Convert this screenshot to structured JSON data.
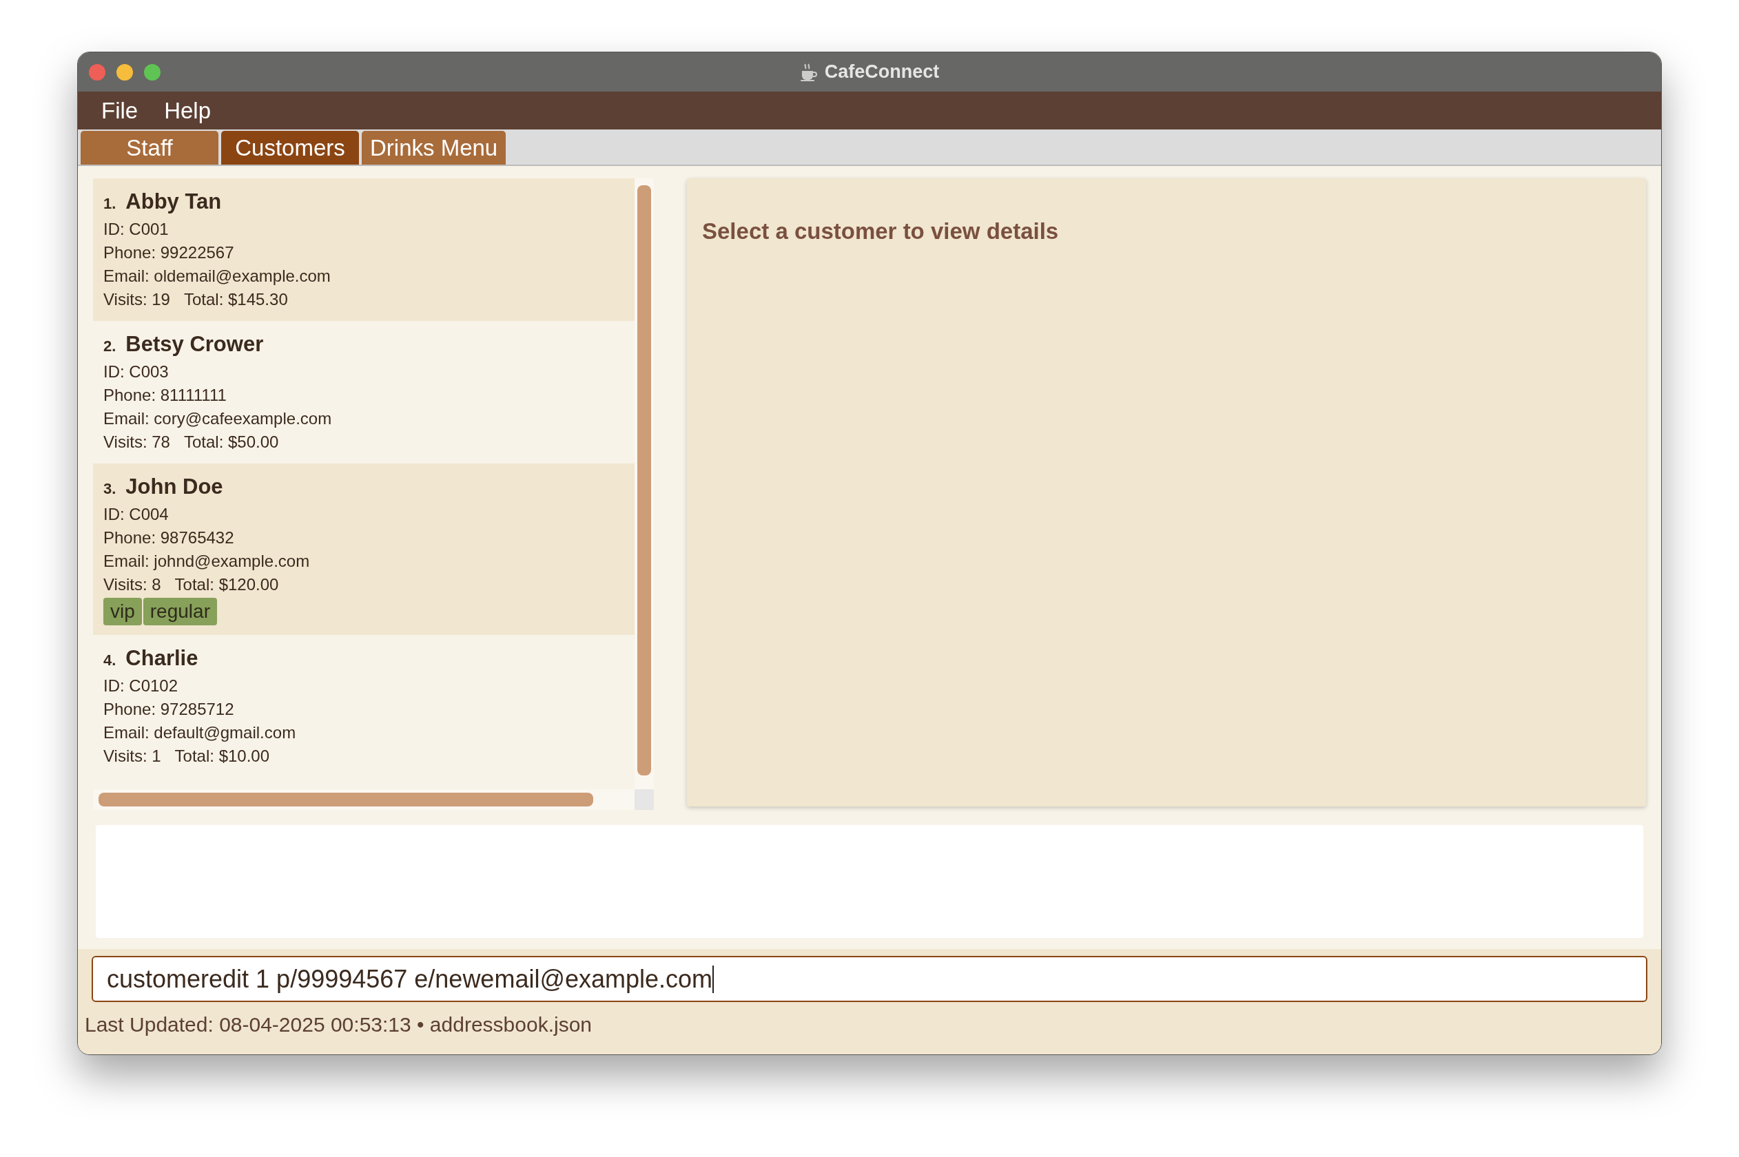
{
  "window": {
    "title": "CafeConnect"
  },
  "menu": [
    "File",
    "Help"
  ],
  "tabs": [
    {
      "label": "Staff",
      "selected": false
    },
    {
      "label": "Customers",
      "selected": true
    },
    {
      "label": "Drinks Menu",
      "selected": false
    }
  ],
  "customers": [
    {
      "index": "1.",
      "name": "Abby Tan",
      "id": "ID: C001",
      "phone": "Phone: 99222567",
      "email": "Email: oldemail@example.com",
      "visits": "Visits: 19",
      "total": "Total: $145.30"
    },
    {
      "index": "2.",
      "name": "Betsy Crower",
      "id": "ID: C003",
      "phone": "Phone: 81111111",
      "email": "Email: cory@cafeexample.com",
      "visits": "Visits: 78",
      "total": "Total: $50.00"
    },
    {
      "index": "3.",
      "name": "John Doe",
      "id": "ID: C004",
      "phone": "Phone: 98765432",
      "email": "Email: johnd@example.com",
      "visits": "Visits: 8",
      "total": "Total: $120.00",
      "tags": [
        "vip",
        "regular"
      ]
    },
    {
      "index": "4.",
      "name": "Charlie",
      "id": "ID: C0102",
      "phone": "Phone: 97285712",
      "email": "Email: default@gmail.com",
      "visits": "Visits: 1",
      "total": "Total: $10.00"
    }
  ],
  "details": {
    "placeholder_message": "Select a customer to view details"
  },
  "command_box": {
    "value": "customeredit 1 p/99994567 e/newemail@example.com"
  },
  "status_bar": "Last Updated: 08-04-2025 00:53:13 • addressbook.json"
}
